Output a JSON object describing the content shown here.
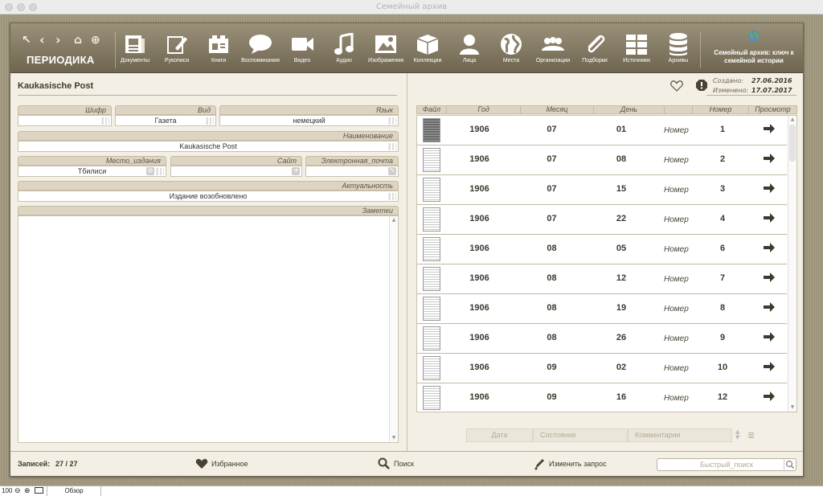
{
  "window": {
    "title": "Семейный архив"
  },
  "header": {
    "section_title": "ПЕРИОДИКА",
    "toolbar": [
      {
        "label": "Документы",
        "icon": "document-icon"
      },
      {
        "label": "Рукописи",
        "icon": "pencil-icon"
      },
      {
        "label": "Книги",
        "icon": "books-icon"
      },
      {
        "label": "Воспоминания",
        "icon": "speech-bubble-icon"
      },
      {
        "label": "Видео",
        "icon": "video-camera-icon"
      },
      {
        "label": "Аудио",
        "icon": "music-note-icon"
      },
      {
        "label": "Изображения",
        "icon": "image-icon"
      },
      {
        "label": "Коллекции",
        "icon": "box-icon"
      },
      {
        "label": "Лица",
        "icon": "person-icon"
      },
      {
        "label": "Места",
        "icon": "globe-icon"
      },
      {
        "label": "Организации",
        "icon": "group-icon"
      },
      {
        "label": "Подборки",
        "icon": "paperclip-icon"
      },
      {
        "label": "Источники",
        "icon": "grid-icon"
      },
      {
        "label": "Архивы",
        "icon": "database-icon"
      }
    ],
    "brand": "Семейный архив: ключ к семейной истории"
  },
  "record": {
    "title": "Kaukasische Post",
    "created_label": "Создано:",
    "created": "27.06.2016",
    "modified_label": "Изменено:",
    "modified": "17.07.2017"
  },
  "fields": {
    "cipher": {
      "label": "Шифр",
      "value": ""
    },
    "kind": {
      "label": "Вид",
      "value": "Газета"
    },
    "language": {
      "label": "Язык",
      "value": "немецкий"
    },
    "name": {
      "label": "Наименование",
      "value": "Kaukasische Post"
    },
    "place": {
      "label": "Место_издания",
      "value": "Тбилиси"
    },
    "site": {
      "label": "Сайт",
      "value": ""
    },
    "email": {
      "label": "Электронная_почта",
      "value": ""
    },
    "relevance": {
      "label": "Актуальность",
      "value": "Издание возобновлено"
    },
    "notes": {
      "label": "Заметки",
      "value": ""
    }
  },
  "issues": {
    "columns": [
      "Файл",
      "Год",
      "Месяц",
      "День",
      "",
      "Номер",
      "Просмотр"
    ],
    "rows": [
      {
        "year": "1906",
        "month": "07",
        "day": "01",
        "label": "Номер",
        "num": "1"
      },
      {
        "year": "1906",
        "month": "07",
        "day": "08",
        "label": "Номер",
        "num": "2"
      },
      {
        "year": "1906",
        "month": "07",
        "day": "15",
        "label": "Номер",
        "num": "3"
      },
      {
        "year": "1906",
        "month": "07",
        "day": "22",
        "label": "Номер",
        "num": "4"
      },
      {
        "year": "1906",
        "month": "08",
        "day": "05",
        "label": "Номер",
        "num": "6"
      },
      {
        "year": "1906",
        "month": "08",
        "day": "12",
        "label": "Номер",
        "num": "7"
      },
      {
        "year": "1906",
        "month": "08",
        "day": "19",
        "label": "Номер",
        "num": "8"
      },
      {
        "year": "1906",
        "month": "08",
        "day": "26",
        "label": "Номер",
        "num": "9"
      },
      {
        "year": "1906",
        "month": "09",
        "day": "02",
        "label": "Номер",
        "num": "10"
      },
      {
        "year": "1906",
        "month": "09",
        "day": "16",
        "label": "Номер",
        "num": "12"
      }
    ],
    "filters": {
      "date": "Дата",
      "state": "Состояние",
      "comments": "Комментарии"
    }
  },
  "footer": {
    "records_label": "Записей:",
    "records_value": "27 / 27",
    "favorites": "Избранное",
    "search": "Поиск",
    "modify": "Изменить запрос",
    "quick_search_placeholder": "Быстрый_поиск"
  },
  "statusbar": {
    "zoom": "100",
    "mode": "Обзор"
  },
  "colors": {
    "header": "#857b64",
    "panel": "#f3efe4",
    "accent": "#4a4232"
  }
}
